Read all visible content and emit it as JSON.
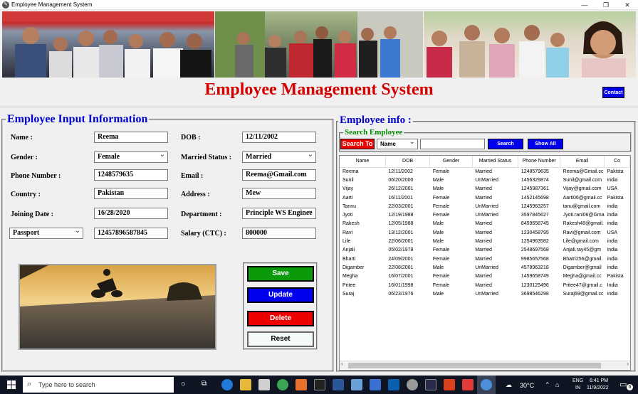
{
  "window": {
    "title": "Employee Management System",
    "minimize": "—",
    "maximize": "❐",
    "close": "✕"
  },
  "header": {
    "title": "Employee Management System",
    "contact_label": "Contact"
  },
  "input_panel": {
    "legend": "Employee Input Information",
    "name_label": "Name :",
    "name_value": "Reema",
    "dob_label": "DOB :",
    "dob_value": "12/11/2002",
    "gender_label": "Gender :",
    "gender_value": "Female",
    "married_label": "Married Status :",
    "married_value": "Married",
    "phone_label": "Phone Number :",
    "phone_value": "1248579635",
    "email_label": "Email :",
    "email_value": "Reema@Gmail.com",
    "country_label": "Country :",
    "country_value": "Pakistan",
    "address_label": "Address :",
    "address_value": "Mew",
    "joining_label": "Joining Date :",
    "joining_value": "16/28/2020",
    "department_label": "Department :",
    "department_value": "Principle WS Enginee",
    "id_type_value": "Passport",
    "id_number_value": "12457896587845",
    "salary_label": "Salary (CTC) :",
    "salary_value": "800000"
  },
  "actions": {
    "save": "Save",
    "update": "Update",
    "delete": "Delete",
    "reset": "Reset"
  },
  "colors": {
    "save": "#0a9a0a",
    "update": "#0000ee",
    "delete": "#ee0000",
    "title_red": "#d40000",
    "legend_blue": "#0000cc",
    "legend_green": "#008800"
  },
  "info_panel": {
    "legend": "Employee info :",
    "search_legend": "Search Employee",
    "search_to_label": "Search To",
    "search_field": "Name",
    "search_value": "",
    "search_button": "Search",
    "show_all_button": "Show All"
  },
  "table": {
    "columns": [
      "Name",
      "DOB",
      "Gender",
      "Married Status",
      "Phone Number",
      "Email",
      "Co"
    ],
    "rows": [
      [
        "Reema",
        "12/11/2002",
        "Female",
        "Married",
        "1248579635",
        "Reema@Gmail.cc",
        "Pakista"
      ],
      [
        "Sunil",
        "06/20/2000",
        "Male",
        "UnMarried",
        "1456329874",
        "Sunil@gmail.com",
        "india"
      ],
      [
        "Vijay",
        "26/12/2001",
        "Male",
        "Married",
        "1245987361",
        "Vijay@gmail.com",
        "USA"
      ],
      [
        "Aarti",
        "16/11/2001",
        "Female",
        "Married",
        "1452145698",
        "Aarti06@gmail.cc",
        "Pakista"
      ],
      [
        "Tannu",
        "22/03/2001",
        "Female",
        "UnMarried",
        "1245963257",
        "tanu@gmail.com",
        "india"
      ],
      [
        "Jyoti",
        "12/19/1988",
        "Female",
        "UnMarried",
        "3597845627",
        "Jyoti.rani06@Gma",
        "india"
      ],
      [
        "Rakesh",
        "12/05/1988",
        "Male",
        "Married",
        "8459658745",
        "Rakesh48@gmail.",
        "india"
      ],
      [
        "Ravi",
        "13/12/2001",
        "Male",
        "Married",
        "1230458795",
        "Ravi@gmail.com",
        "USA"
      ],
      [
        "Life",
        "22/06/2001",
        "Male",
        "Married",
        "1254963582",
        "Life@gmail.com",
        "india"
      ],
      [
        "Anjali",
        "05/02/1978",
        "Female",
        "Married",
        "2548697568",
        "Anjali.ray45@gm",
        "india"
      ],
      [
        "Bharti",
        "24/09/2001",
        "Female",
        "Married",
        "9985657568",
        "Bhatri256@gmail.",
        "india"
      ],
      [
        "Digamber",
        "22/08/2001",
        "Male",
        "UnMarried",
        "4578963218",
        "Digamber@gmail",
        "india"
      ],
      [
        "Megha",
        "16/07/2001",
        "Female",
        "Married",
        "1459658749",
        "Megha@gmail.cc",
        "Pakista"
      ],
      [
        "Pritee",
        "16/01/1998",
        "Female",
        "Married",
        "1230125496",
        "Pritee47@gmail.c",
        "India"
      ],
      [
        "Suraj",
        "06/23/1976",
        "Male",
        "UnMarried",
        "3698546298",
        "Suraj69@gmail.cc",
        "india"
      ]
    ]
  },
  "taskbar": {
    "search_placeholder": "Type here to search",
    "weather": "30°C",
    "lang_top": "ENG",
    "lang_bottom": "IN",
    "time": "6:41 PM",
    "date": "11/9/2022",
    "notification_badge": "6"
  }
}
